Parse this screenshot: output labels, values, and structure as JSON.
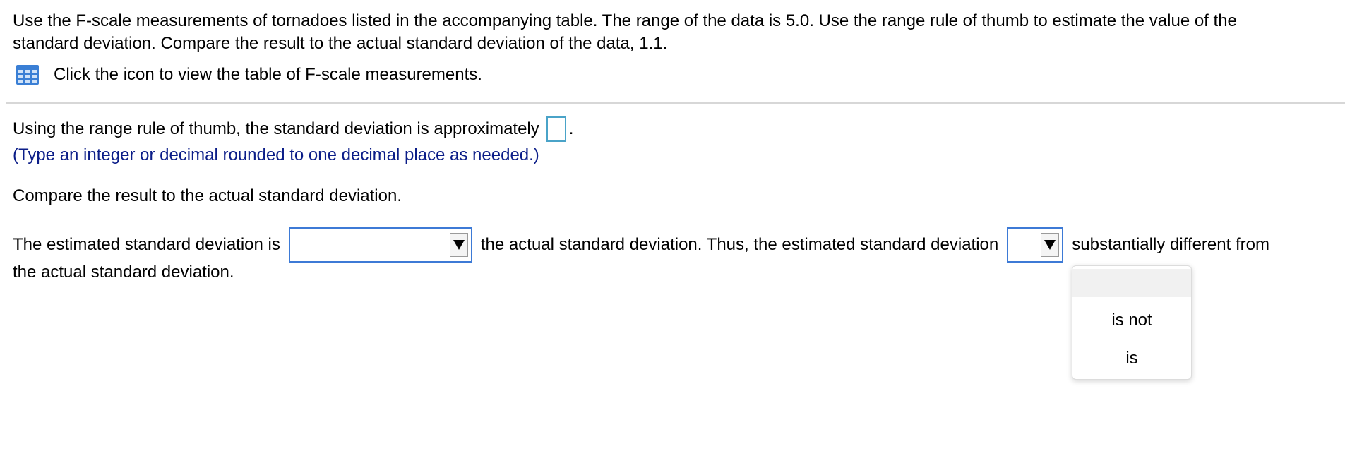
{
  "question": {
    "line1": "Use the F-scale measurements of tornadoes listed in the accompanying table. The range of the data is 5.0. Use the range rule of thumb to estimate the value of the",
    "line2": "standard deviation. Compare the result to the actual standard deviation of the data, 1.1."
  },
  "table_link": {
    "icon": "table-grid-icon",
    "label": "Click the icon to view the table of F-scale measurements."
  },
  "part1": {
    "prompt": "Using the range rule of thumb, the standard deviation is approximately",
    "answer_value": "",
    "suffix": ".",
    "hint": "(Type an integer or decimal rounded to one decimal place as needed.)"
  },
  "part2": {
    "prompt": "Compare the result to the actual standard deviation."
  },
  "part3": {
    "text_before": "The estimated standard deviation is",
    "select1_value": "",
    "text_middle": "the actual standard deviation. Thus, the estimated standard deviation",
    "select2_value": "",
    "text_after": "substantially different from",
    "text_tail": "the actual standard deviation."
  },
  "dropdown": {
    "options": [
      "",
      "is not",
      "is"
    ]
  },
  "colors": {
    "hint_text": "#0b1d88",
    "select_border": "#3d7ad6",
    "input_border": "#4aa3c8",
    "icon_blue": "#3a7fd5"
  }
}
